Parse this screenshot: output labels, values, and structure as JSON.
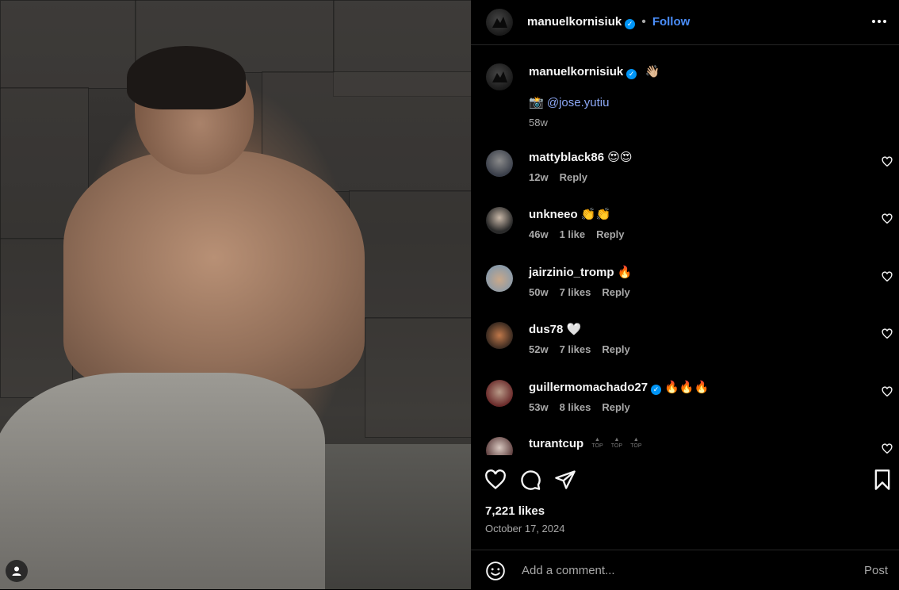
{
  "post": {
    "username": "manuelkornisiuk",
    "follow_label": "Follow",
    "separator": "•"
  },
  "caption": {
    "username": "manuelkornisiuk",
    "emoji": "👋🏼",
    "camera_emoji": "📸",
    "mention": "@jose.yutiu",
    "time": "58w"
  },
  "comments": [
    {
      "username": "mattyblack86",
      "text": "😍😍",
      "time": "12w",
      "likes": "",
      "reply": "Reply",
      "verified": false
    },
    {
      "username": "unkneeo",
      "text": "👏👏",
      "time": "46w",
      "likes": "1 like",
      "reply": "Reply",
      "verified": false
    },
    {
      "username": "jairzinio_tromp",
      "text": "🔥",
      "time": "50w",
      "likes": "7 likes",
      "reply": "Reply",
      "verified": false
    },
    {
      "username": "dus78",
      "text": "🤍",
      "time": "52w",
      "likes": "7 likes",
      "reply": "Reply",
      "verified": false
    },
    {
      "username": "guillermomachado27",
      "text": "🔥🔥🔥",
      "time": "53w",
      "likes": "8 likes",
      "reply": "Reply",
      "verified": true
    },
    {
      "username": "turantcup",
      "text": "",
      "time": "",
      "likes": "",
      "reply": "",
      "verified": false
    }
  ],
  "top_badge": "TOP",
  "likes_count": "7,221 likes",
  "date": "October 17, 2024",
  "comment_box": {
    "placeholder": "Add a comment...",
    "post_label": "Post"
  },
  "icons": [
    "heart-icon",
    "comment-icon",
    "share-icon",
    "bookmark-icon",
    "emoji-icon",
    "more-icon",
    "verified-icon",
    "user-tag-icon"
  ],
  "colors": {
    "accent": "#4a8df8",
    "verified": "#0095f6",
    "muted": "#a8a8a8",
    "background": "#000000"
  }
}
